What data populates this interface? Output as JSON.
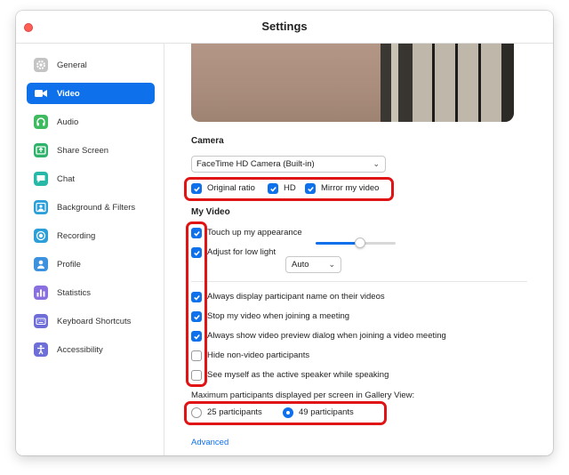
{
  "window": {
    "title": "Settings"
  },
  "sidebar": {
    "items": [
      {
        "label": "General",
        "icon": "gear-icon",
        "color": "#c4c4c4",
        "active": false
      },
      {
        "label": "Video",
        "icon": "video-camera-icon",
        "color": "#0e71eb",
        "active": true
      },
      {
        "label": "Audio",
        "icon": "headphones-icon",
        "color": "#3dbb5e",
        "active": false
      },
      {
        "label": "Share Screen",
        "icon": "share-screen-icon",
        "color": "#2fb36a",
        "active": false
      },
      {
        "label": "Chat",
        "icon": "chat-icon",
        "color": "#28b8a8",
        "active": false
      },
      {
        "label": "Background & Filters",
        "icon": "background-icon",
        "color": "#2c9fd9",
        "active": false
      },
      {
        "label": "Recording",
        "icon": "recording-icon",
        "color": "#2c9fd9",
        "active": false
      },
      {
        "label": "Profile",
        "icon": "profile-icon",
        "color": "#3d92e0",
        "active": false
      },
      {
        "label": "Statistics",
        "icon": "statistics-icon",
        "color": "#8a6fe0",
        "active": false
      },
      {
        "label": "Keyboard Shortcuts",
        "icon": "keyboard-icon",
        "color": "#6e6ed8",
        "active": false
      },
      {
        "label": "Accessibility",
        "icon": "accessibility-icon",
        "color": "#6e6ed8",
        "active": false
      }
    ]
  },
  "camera": {
    "section_title": "Camera",
    "selected_camera": "FaceTime HD Camera (Built-in)",
    "options": [
      {
        "label": "Original ratio",
        "checked": true
      },
      {
        "label": "HD",
        "checked": true
      },
      {
        "label": "Mirror my video",
        "checked": true
      }
    ]
  },
  "my_video": {
    "section_title": "My Video",
    "touch_up": {
      "label": "Touch up my appearance",
      "checked": true,
      "level": 0.55
    },
    "low_light": {
      "label": "Adjust for low light",
      "checked": true,
      "mode": "Auto"
    },
    "options": [
      {
        "label": "Always display participant name on their videos",
        "checked": true
      },
      {
        "label": "Stop my video when joining a meeting",
        "checked": true
      },
      {
        "label": "Always show video preview dialog when joining a video meeting",
        "checked": true
      },
      {
        "label": "Hide non-video participants",
        "checked": false
      },
      {
        "label": "See myself as the active speaker while speaking",
        "checked": false
      }
    ]
  },
  "gallery": {
    "label": "Maximum participants displayed per screen in Gallery View:",
    "choices": [
      {
        "label": "25 participants",
        "selected": false
      },
      {
        "label": "49 participants",
        "selected": true
      }
    ]
  },
  "advanced_link": "Advanced",
  "colors": {
    "accent": "#0e71eb",
    "highlight": "#e01414",
    "close_button": "#ff5f57"
  }
}
